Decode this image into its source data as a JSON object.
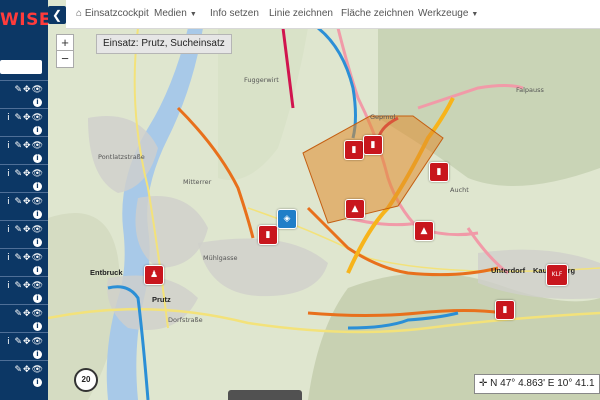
{
  "brand": {
    "text": "WISE",
    "color": "#ff3b3b"
  },
  "sidebar": {
    "background": "#0c3765",
    "rows": [
      {
        "icons": "✎✥👁"
      },
      {
        "icons": "i ✎✥👁"
      },
      {
        "icons": "i ✎✥👁"
      },
      {
        "icons": "i ✎✥👁"
      },
      {
        "icons": "i ✎✥👁"
      },
      {
        "icons": "i ✎✥👁"
      },
      {
        "icons": "i ✎✥👁"
      },
      {
        "icons": "i ✎✥👁"
      },
      {
        "icons": "✎✥👁"
      },
      {
        "icons": "i ✎✥👁"
      },
      {
        "icons": "✎✥👁"
      }
    ]
  },
  "topnav": {
    "cockpit": "Einsatzcockpit",
    "medien": "Medien",
    "info": "Info setzen",
    "linie": "Linie zeichnen",
    "flaeche": "Fläche zeichnen",
    "werkzeuge": "Werkzeuge"
  },
  "map": {
    "zoom_in": "+",
    "zoom_out": "−",
    "label": "Einsatz: Prutz, Sucheinsatz",
    "places": {
      "fuggerwirt": "Fuggerwirt",
      "pontlatz": "Pontlatzstraße",
      "mitterrer": "Mitterrer",
      "muhlgasse": "Mühlgasse",
      "entbruck": "Entbruck",
      "prutz": "Prutz",
      "dorfstrasse": "Dorfstraße",
      "gepmol": "Gepmol",
      "aucht": "Aucht",
      "faljauss": "Falpauss",
      "unterdorf": "Unterdorf",
      "kaunerberg": "Kaunerberg"
    },
    "area_color": "#e08a2c",
    "marker_klf": "KLF",
    "scale_label": "20"
  },
  "coords": {
    "lat": "N 47° 4.863'",
    "lon": "E 10° 41.1"
  }
}
